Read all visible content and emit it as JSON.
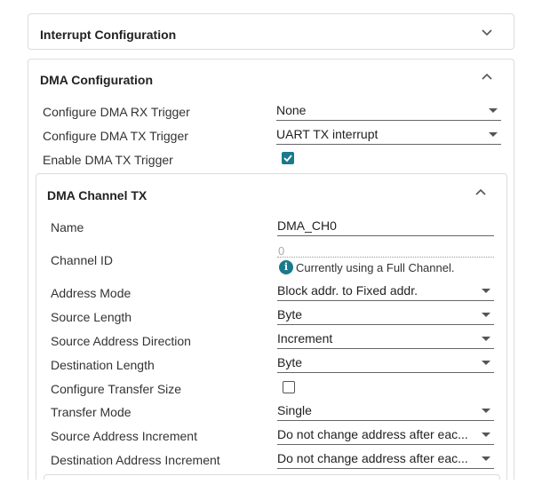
{
  "interrupt": {
    "title": "Interrupt Configuration"
  },
  "dma": {
    "title": "DMA Configuration",
    "rx_trigger": {
      "label": "Configure DMA RX Trigger",
      "value": "None"
    },
    "tx_trigger": {
      "label": "Configure DMA TX Trigger",
      "value": "UART TX interrupt"
    },
    "enable_tx": {
      "label": "Enable DMA TX Trigger",
      "checked": true
    }
  },
  "channel": {
    "title": "DMA Channel TX",
    "name": {
      "label": "Name",
      "value": "DMA_CH0"
    },
    "channel_id": {
      "label": "Channel ID",
      "value": "0",
      "note": "Currently using a Full Channel."
    },
    "address_mode": {
      "label": "Address Mode",
      "value": "Block addr. to Fixed addr."
    },
    "source_length": {
      "label": "Source Length",
      "value": "Byte"
    },
    "source_dir": {
      "label": "Source Address Direction",
      "value": "Increment"
    },
    "dest_length": {
      "label": "Destination Length",
      "value": "Byte"
    },
    "transfer_size": {
      "label": "Configure Transfer Size",
      "checked": false
    },
    "transfer_mode": {
      "label": "Transfer Mode",
      "value": "Single"
    },
    "src_inc": {
      "label": "Source Address Increment",
      "value": "Do not change address after eac..."
    },
    "dst_inc": {
      "label": "Destination Address Increment",
      "value": "Do not change address after eac..."
    }
  },
  "colors": {
    "accent": "#1a7a8c",
    "border": "#dcdcdc"
  }
}
